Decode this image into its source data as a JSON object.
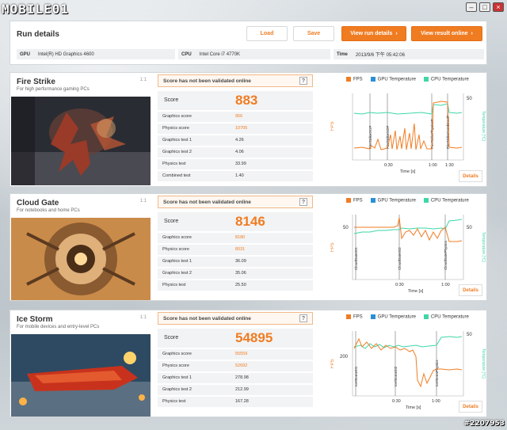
{
  "watermark": {
    "site": "MOBILE01",
    "id": "#2207953"
  },
  "header": {
    "title": "Run details",
    "buttons": {
      "load": "Load",
      "save": "Save",
      "view_run": "View run details",
      "view_online": "View result online"
    },
    "info": {
      "gpu_key": "GPU",
      "gpu_val": "Intel(R) HD Graphics 4600",
      "cpu_key": "CPU",
      "cpu_val": "Intel Core i7 4770K",
      "time_key": "Time",
      "time_val": "2013/9/6 下午 05:42:06"
    }
  },
  "legend": {
    "fps": "FPS",
    "gpu_temp": "GPU Temperature",
    "cpu_temp": "CPU Temperature"
  },
  "colors": {
    "fps": "#f07c22",
    "gpu": "#2b8fd6",
    "cpu": "#3ed6a8",
    "accent": "#f07c22"
  },
  "tests": [
    {
      "name": "Fire Strike",
      "subtitle": "For high performance gaming PCs",
      "ratio": "1:1",
      "validation": "Score has not been validated online",
      "score_label": "Score",
      "score": "883",
      "rows": [
        {
          "k": "Graphics score",
          "v": "956",
          "orange": true
        },
        {
          "k": "Physics score",
          "v": "10705",
          "orange": true
        },
        {
          "k": "Graphics test 1",
          "v": "4.26",
          "orange": false
        },
        {
          "k": "Graphics test 2",
          "v": "4.06",
          "orange": false
        },
        {
          "k": "Physics test",
          "v": "33.99",
          "orange": false
        },
        {
          "k": "Combined test",
          "v": "1.40",
          "orange": false
        }
      ],
      "details": "Details",
      "chart": {
        "left_axis": "FPS",
        "right_axis": "Temperature [°C]",
        "right_tick": "50",
        "xticks": [
          "0:30",
          "1:00",
          "1:30"
        ],
        "xlabel": "Time [s]",
        "markers": [
          "FireStrikeGt1P",
          "FireStrikeGt2P",
          "FireStrikePhysicsP",
          "FireStrikeCombinedP"
        ]
      }
    },
    {
      "name": "Cloud Gate",
      "subtitle": "For notebooks and home PCs",
      "ratio": "1:1",
      "validation": "Score has not been validated online",
      "score_label": "Score",
      "score": "8146",
      "rows": [
        {
          "k": "Graphics score",
          "v": "8180",
          "orange": true
        },
        {
          "k": "Physics score",
          "v": "8031",
          "orange": true
        },
        {
          "k": "Graphics test 1",
          "v": "36.09",
          "orange": false
        },
        {
          "k": "Graphics test 2",
          "v": "35.06",
          "orange": false
        },
        {
          "k": "Physics test",
          "v": "25.50",
          "orange": false
        }
      ],
      "details": "Details",
      "chart": {
        "left_axis": "FPS",
        "left_tick": "50",
        "right_axis": "Temperature [°C]",
        "right_tick": "50",
        "xticks": [
          "0:30",
          "1:00"
        ],
        "xlabel": "Time [s]",
        "markers": [
          "CloudGateGt1",
          "CloudGateGt2",
          "CloudGatePhysics"
        ]
      }
    },
    {
      "name": "Ice Storm",
      "subtitle": "For mobile devices and entry-level PCs",
      "ratio": "1:1",
      "validation": "Score has not been validated online",
      "score_label": "Score",
      "score": "54895",
      "rows": [
        {
          "k": "Graphics score",
          "v": "55559",
          "orange": true
        },
        {
          "k": "Physics score",
          "v": "52692",
          "orange": true
        },
        {
          "k": "Graphics test 1",
          "v": "278.98",
          "orange": false
        },
        {
          "k": "Graphics test 2",
          "v": "212.99",
          "orange": false
        },
        {
          "k": "Physics test",
          "v": "167.28",
          "orange": false
        }
      ],
      "details": "Details",
      "chart": {
        "left_axis": "FPS",
        "left_tick": "200",
        "right_axis": "Temperature [°C]",
        "right_tick": "50",
        "xticks": [
          "0:30",
          "1:00"
        ],
        "xlabel": "Time [s]",
        "markers": [
          "IceStormGt1",
          "IceStormGt2",
          "IceStormPhysics"
        ]
      }
    }
  ]
}
